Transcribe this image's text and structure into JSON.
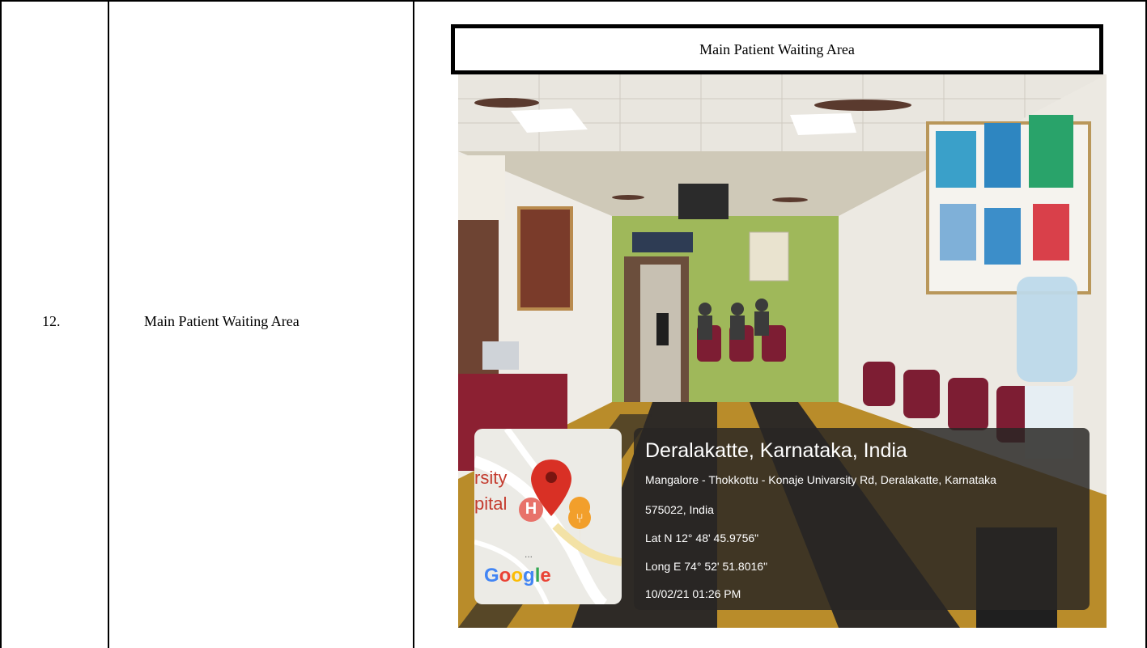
{
  "row": {
    "serial": "12.",
    "description": "Main Patient Waiting Area",
    "caption": "Main Patient Waiting Area"
  },
  "gps": {
    "place": "Deralakatte, Karnataka, India",
    "address_line1": "Mangalore - Thokkottu - Konaje Univarsity Rd, Deralakatte, Karnataka",
    "address_line2": "575022, India",
    "latitude": "Lat N 12° 48' 45.9756\"",
    "longitude": "Long E 74° 52' 51.8016\"",
    "datetime": "10/02/21 01:26 PM"
  },
  "map": {
    "label_university": "rsity",
    "label_hospital": "pital",
    "hospital_marker": "H",
    "ellipsis": "...",
    "brand": "Google",
    "brand_colors": [
      "#4285F4",
      "#EA4335",
      "#FBBC05",
      "#4285F4",
      "#34A853",
      "#EA4335"
    ],
    "pin_color": "#d93025",
    "hospital_color": "#e8726a",
    "restaurant_color": "#f29f2b"
  }
}
